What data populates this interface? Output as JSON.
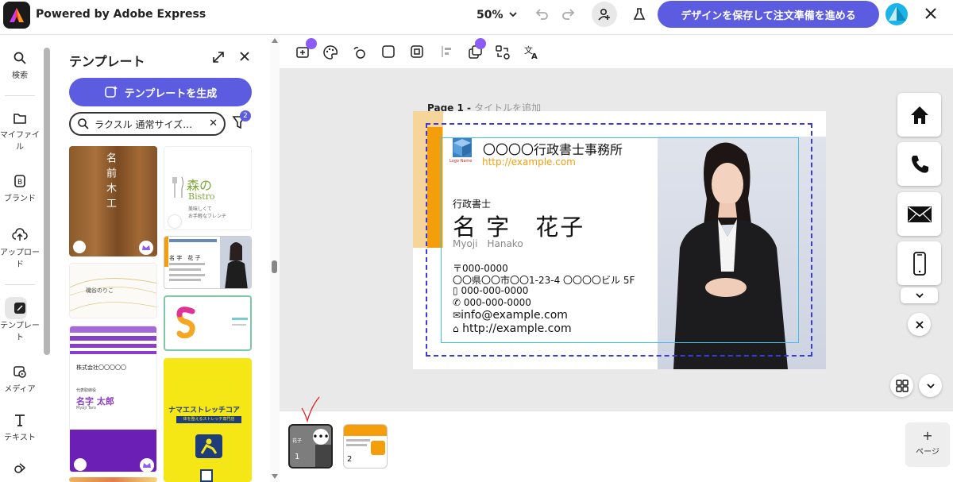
{
  "topbar": {
    "brand": "Powered by Adobe Express",
    "zoom": "50%",
    "cta": "デザインを保存して注文準備を進める"
  },
  "rail": {
    "items": [
      {
        "label": "検索"
      },
      {
        "label": "マイファイル"
      },
      {
        "label": "ブランド"
      },
      {
        "label": "アップロード"
      },
      {
        "label": "テンプレート"
      },
      {
        "label": "メディア"
      },
      {
        "label": "テキスト"
      }
    ]
  },
  "panel": {
    "title": "テンプレート",
    "generate_label": "テンプレートを生成",
    "search_value": "ラクスル 通常サイズ…",
    "filter_count": "2",
    "templates": {
      "t1_text": "名前木工",
      "t2_title": "森の",
      "t2_sub": "Bistro",
      "t2_desc1": "美味しくて",
      "t2_desc2": "お手軽なフレンチ",
      "t4_text": "磯谷のりこ",
      "t6_company": "株式会社〇〇〇〇〇",
      "t6_role": "代表取締役",
      "t6_name": "名字 太郎",
      "t6_roman": "Myoji Taro",
      "t7_title": "ナマエストレッチコア",
      "t7_sub": "体を整えるストレッチ専門店"
    }
  },
  "canvas": {
    "page_label": "Page 1 - ",
    "page_placeholder": "タイトルを追加",
    "card": {
      "office": "〇〇〇〇行政書士事務所",
      "url_top": "http://example.com",
      "logo_text": "Logo Name",
      "role": "行政書士",
      "name": "名 字　花子",
      "roman": "Myoji　Hanako",
      "postal": "〒000-0000",
      "address": "〇〇県〇〇市〇〇1-23-4 〇〇〇〇ビル 5F",
      "mobile": "000-000-0000",
      "phone": "000-000-0000",
      "email": "info@example.com",
      "web": "http://example.com"
    }
  },
  "pages": {
    "p1": "1",
    "p2": "2",
    "add_label": "ページ"
  },
  "colors": {
    "accent": "#5c5ce0",
    "orange": "#f59e0b",
    "dashed": "#3a3ae0",
    "safe": "#3fc1ea"
  }
}
